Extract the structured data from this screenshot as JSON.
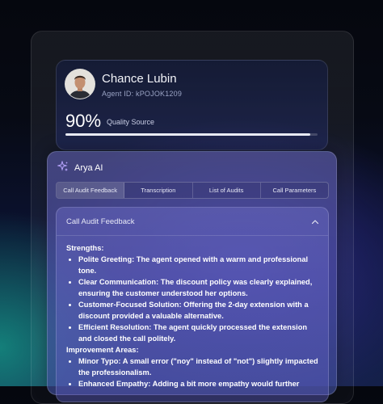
{
  "agent": {
    "name": "Chance Lubin",
    "id_label": "Agent ID: kPOJOK1209",
    "score": "90%",
    "score_label": "Quality Source",
    "progress": 0.97
  },
  "arya": {
    "title": "Arya AI",
    "tabs": [
      {
        "label": "Call Audit Feedback",
        "active": true
      },
      {
        "label": "Transcription",
        "active": false
      },
      {
        "label": "List of Audits",
        "active": false
      },
      {
        "label": "Call Parameters",
        "active": false
      }
    ]
  },
  "feedback": {
    "title": "Call Audit Feedback",
    "strengths_heading": "Strengths:",
    "strengths": [
      "Polite Greeting: The agent opened with a warm and professional tone.",
      "Clear Communication: The discount policy was clearly explained, ensuring the customer understood her options.",
      "Customer-Focused Solution: Offering the 2-day extension with a discount provided a valuable alternative.",
      "Efficient Resolution: The agent quickly processed the extension and closed the call politely."
    ],
    "improvement_heading": "Improvement Areas:",
    "improvements": [
      "Minor Typo: A small error (\"noy\" instead of \"not\") slightly impacted the professionalism.",
      "Enhanced Empathy: Adding a bit more empathy would further"
    ]
  },
  "icons": {
    "sparkle": "sparkle-icon",
    "collapse": "chevron-up-icon"
  }
}
